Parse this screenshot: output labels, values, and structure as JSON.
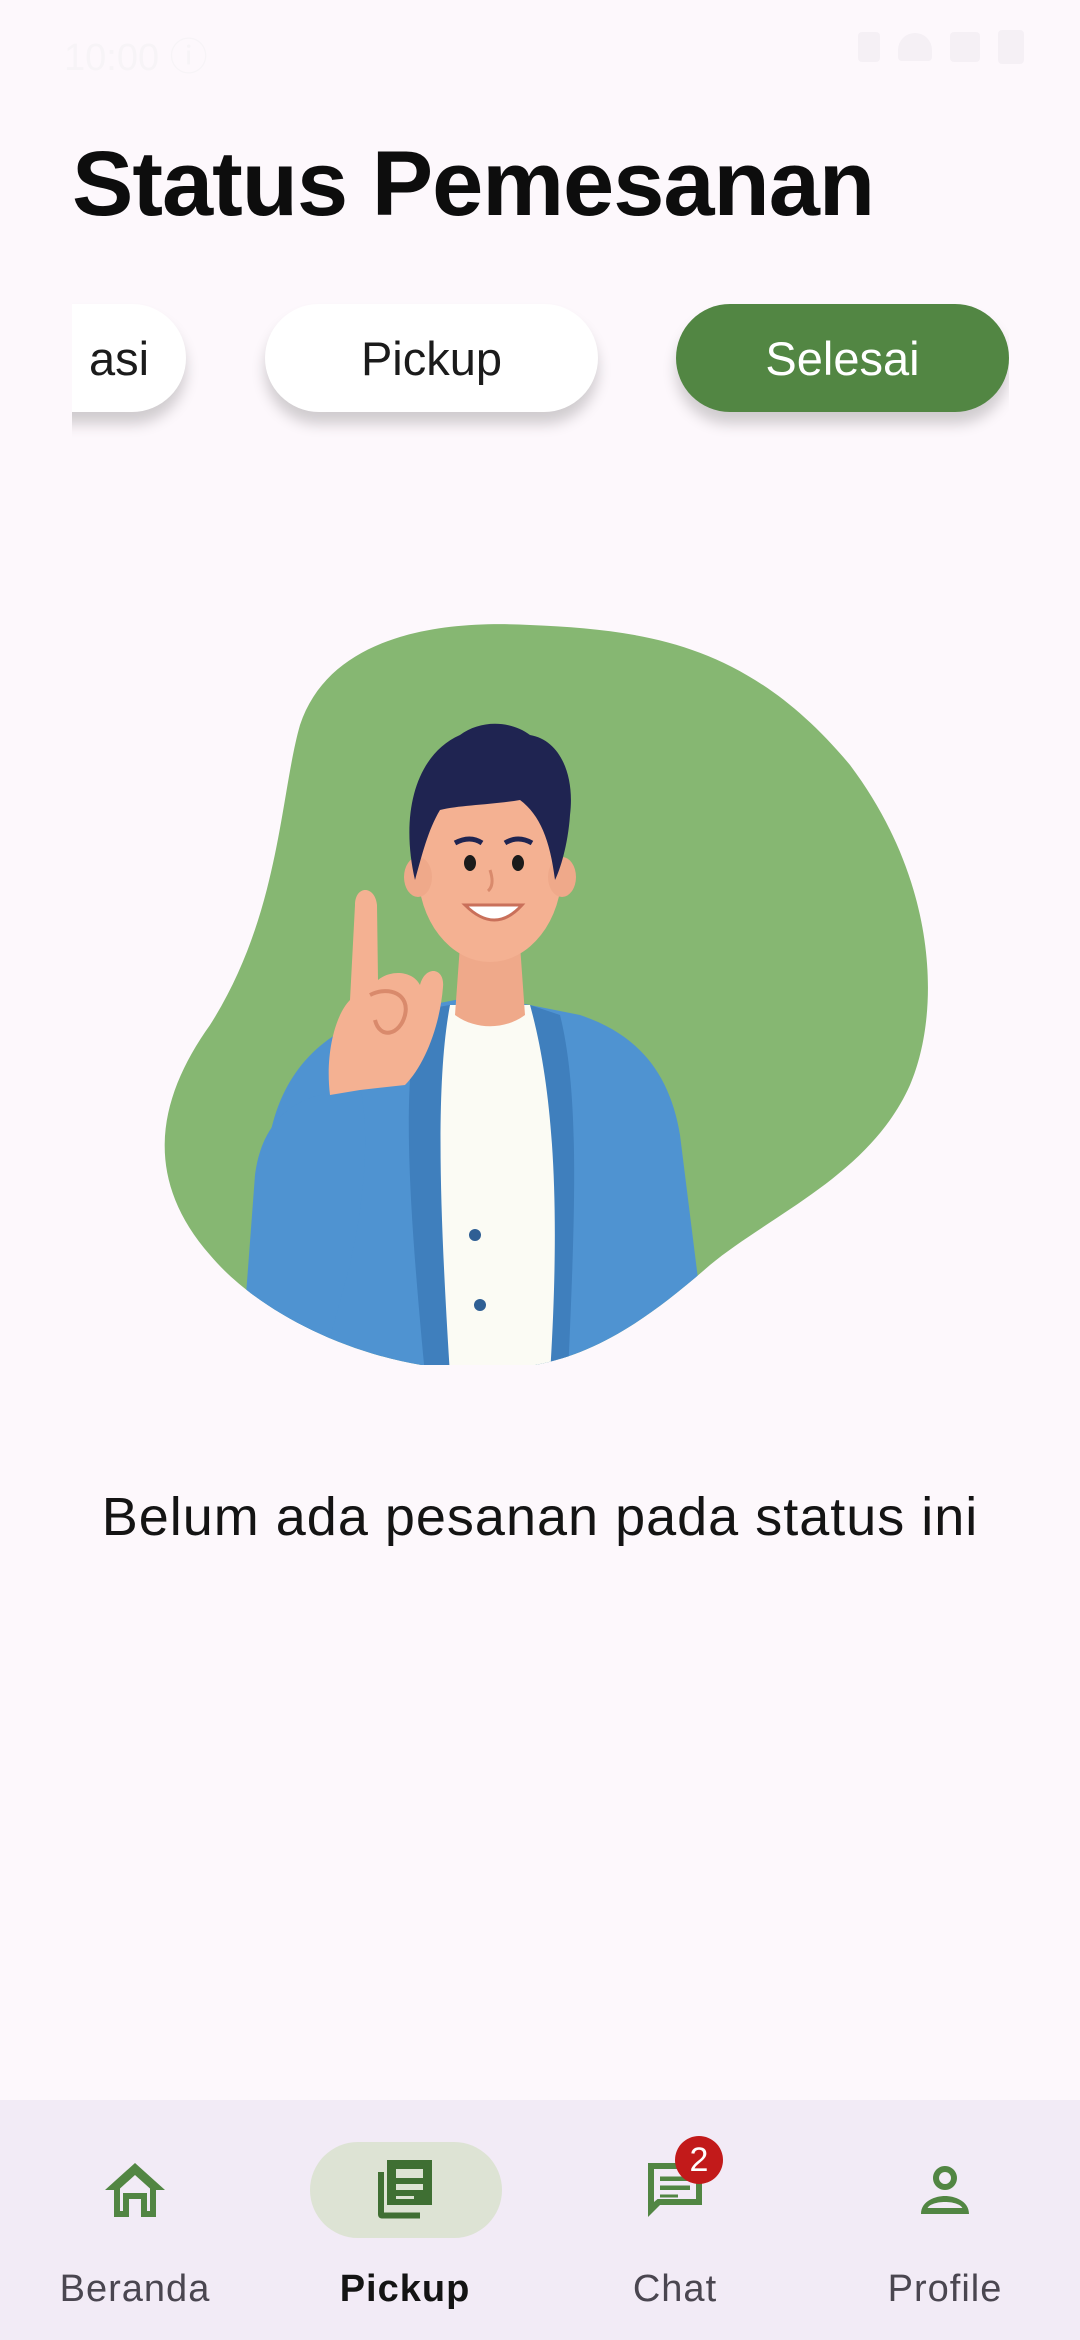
{
  "status_bar": {
    "time": "10:00 ⓘ"
  },
  "header": {
    "title": "Status Pemesanan"
  },
  "tabs": [
    {
      "label": "asi",
      "selected": false
    },
    {
      "label": "Pickup",
      "selected": false
    },
    {
      "label": "Selesai",
      "selected": true
    }
  ],
  "colors": {
    "accent": "#528643",
    "blob": "#86b772",
    "background": "#fdf8fc",
    "nav_background": "#f2ebf6",
    "badge": "#c21a1a"
  },
  "empty_state": {
    "message": "Belum ada pesanan pada status ini"
  },
  "bottom_nav": {
    "items": [
      {
        "label": "Beranda",
        "icon": "home-icon",
        "active": false
      },
      {
        "label": "Pickup",
        "icon": "article-icon",
        "active": true
      },
      {
        "label": "Chat",
        "icon": "chat-icon",
        "active": false
      },
      {
        "label": "Profile",
        "icon": "person-icon",
        "active": false
      }
    ],
    "chat_badge": "2"
  }
}
